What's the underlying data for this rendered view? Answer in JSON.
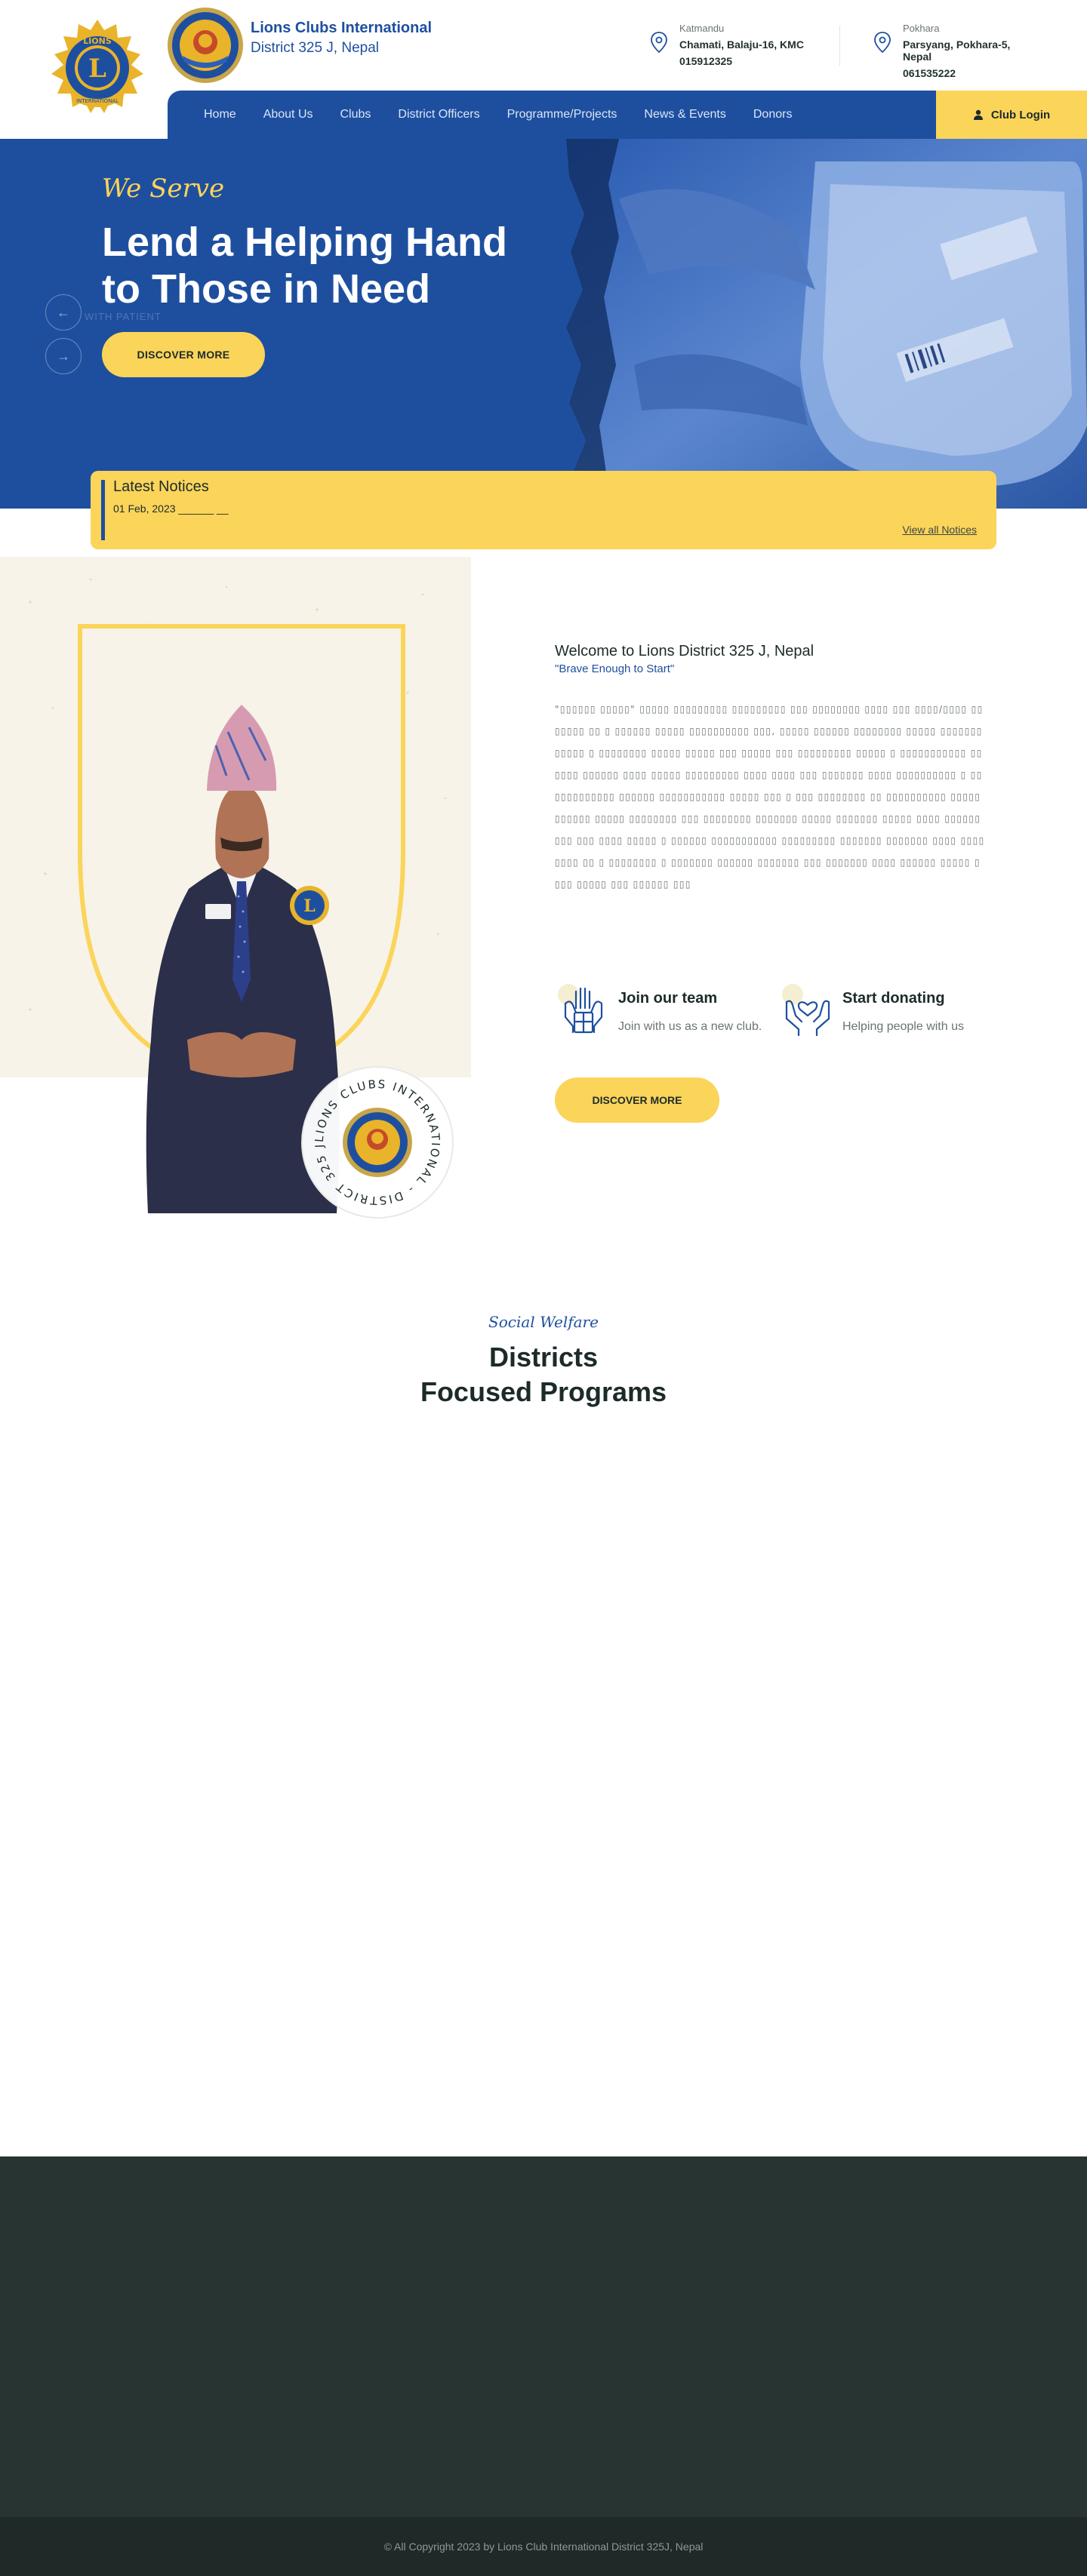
{
  "brand": {
    "line1": "Lions Clubs International",
    "line2": "District 325 J, Nepal",
    "seal_text": "LIONS CLUBS INTERNATIONAL - DISTRICT 325 J, NEPAL - "
  },
  "contacts": [
    {
      "city": "Katmandu",
      "address": "Chamati, Balaju-16, KMC",
      "phone": "015912325"
    },
    {
      "city": "Pokhara",
      "address": "Parsyang, Pokhara-5, Nepal",
      "phone": "061535222"
    }
  ],
  "nav": {
    "items": [
      "Home",
      "About Us",
      "Clubs",
      "District Officers",
      "Programme/Projects",
      "News & Events",
      "Donors"
    ],
    "login_label": "Club Login"
  },
  "hero": {
    "tagline": "We Serve",
    "title_line1": "Lend a Helping Hand",
    "title_line2": "to Those in Need",
    "button": "DISCOVER MORE",
    "ghost_text": "WITH PATIENT"
  },
  "notices": {
    "title": "Latest Notices",
    "item": "01 Feb, 2023 ______ __",
    "view_all": "View all Notices"
  },
  "about": {
    "welcome": "Welcome to Lions District 325 J, Nepal",
    "motto": "\"Brave Enough to Start\"",
    "paragraph": "\"▯▯▯▯▯▯ ▯▯▯▯▯\" ▯▯▯▯▯ ▯▯▯▯▯▯▯▯▯ ▯▯▯▯▯▯▯▯▯ ▯▯▯ ▯▯▯▯▯▯▯▯ ▯▯▯▯ ▯▯▯ ▯▯▯▯/▯▯▯▯ ▯▯ ▯▯▯▯▯ ▯▯ ▯ ▯▯▯▯▯▯ ▯▯▯▯▯ ▯▯▯▯▯▯▯▯▯▯ ▯▯▯, ▯▯▯▯▯ ▯▯▯▯▯▯ ▯▯▯▯▯▯▯▯ ▯▯▯▯▯ ▯▯▯▯▯▯▯ ▯▯▯▯▯ ▯ ▯▯▯▯▯▯▯▯ ▯▯▯▯▯ ▯▯▯▯▯ ▯▯▯ ▯▯▯▯▯ ▯▯▯ ▯▯▯▯▯▯▯▯▯ ▯▯▯▯▯ ▯ ▯▯▯▯▯▯▯▯▯▯▯ ▯▯▯▯▯▯ ▯▯▯▯▯▯ ▯▯▯▯ ▯▯▯▯▯ ▯▯▯▯▯▯▯▯▯ ▯▯▯▯ ▯▯▯▯ ▯▯▯ ▯▯▯▯▯▯▯ ▯▯▯▯ ▯▯▯▯▯▯▯▯▯▯ ▯ ▯▯▯▯▯▯▯▯▯▯▯▯ ▯▯▯▯▯▯ ▯▯▯▯▯▯▯▯▯▯▯ ▯▯▯▯▯ ▯▯▯ ▯ ▯▯▯ ▯▯▯▯▯▯▯▯ ▯▯ ▯▯▯▯▯▯▯▯▯▯ ▯▯▯▯▯▯▯▯▯▯▯ ▯▯▯▯▯ ▯▯▯▯▯▯▯▯ ▯▯▯ ▯▯▯▯▯▯▯▯ ▯▯▯▯▯▯▯ ▯▯▯▯▯ ▯▯▯▯▯▯▯ ▯▯▯▯▯ ▯▯▯▯ ▯▯▯▯▯▯▯▯▯ ▯▯▯ ▯▯▯▯ ▯▯▯▯▯ ▯ ▯▯▯▯▯▯ ▯▯▯▯▯▯▯▯▯▯▯ ▯▯▯▯▯▯▯▯▯ ▯▯▯▯▯▯▯ ▯▯▯▯▯▯▯ ▯▯▯▯ ▯▯▯▯▯▯▯▯ ▯▯ ▯ ▯▯▯▯▯▯▯▯ ▯ ▯▯▯▯▯▯▯ ▯▯▯▯▯▯ ▯▯▯▯▯▯▯ ▯▯▯ ▯▯▯▯▯▯▯ ▯▯▯▯ ▯▯▯▯▯▯ ▯▯▯▯▯ ▯▯▯▯ ▯▯▯▯▯ ▯▯▯ ▯▯▯▯▯▯ ▯▯▯",
    "features": [
      {
        "title": "Join our team",
        "desc": "Join with us as a new club."
      },
      {
        "title": "Start donating",
        "desc": "Helping people with us"
      }
    ],
    "button": "DISCOVER MORE"
  },
  "programs": {
    "tagline": "Social Welfare",
    "title_line1": "Districts",
    "title_line2": "Focused Programs"
  },
  "footer": {
    "copyright": "© All Copyright 2023 by Lions Club International District 325J, Nepal"
  },
  "colors": {
    "primary_blue": "#1e4f9f",
    "accent_yellow": "#fbd45a",
    "footer_dark": "#283432"
  }
}
